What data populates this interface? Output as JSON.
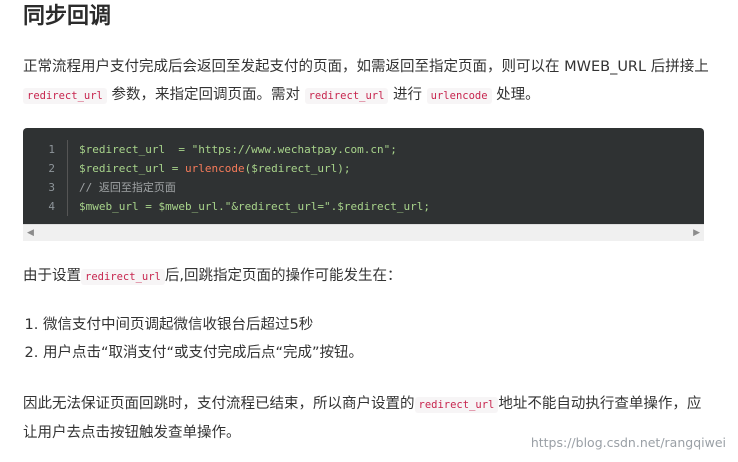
{
  "heading": "同步回调",
  "para1": {
    "text_a": "正常流程用户支付完成后会返回至发起支付的页面，如需返回至指定页面，则可以在 MWEB_URL 后拼接上 ",
    "code_a": "redirect_url",
    "text_b": " 参数，来指定回调页面。需对 ",
    "code_b": "redirect_url",
    "text_c": " 进行 ",
    "code_c": "urlencode",
    "text_d": " 处理。"
  },
  "code_block": {
    "lines": [
      {
        "num": "1",
        "text": "$redirect_url  = \"https://www.wechatpay.com.cn\";"
      },
      {
        "num": "2",
        "pre": "$redirect_url = ",
        "fn": "urlencode",
        "post": "($redirect_url);"
      },
      {
        "num": "3",
        "comment": "// 返回至指定页面"
      },
      {
        "num": "4",
        "text": "$mweb_url = $mweb_url.\"&redirect_url=\".$redirect_url;"
      }
    ]
  },
  "para2": {
    "text_a": "由于设置",
    "code_a": "redirect_url",
    "text_b": "后,回跳指定页面的操作可能发生在："
  },
  "list": [
    "微信支付中间页调起微信收银台后超过5秒",
    "用户点击“取消支付“或支付完成后点“完成”按钮。"
  ],
  "para3": {
    "text_a": "因此无法保证页面回跳时，支付流程已结束，所以商户设置的",
    "code_a": "redirect_url",
    "text_b": "地址不能自动执行查单操作，应让用户去点击按钮触发查单操作。"
  },
  "watermark": "https://blog.csdn.net/rangqiwei",
  "icons": {
    "scroll_left": "triangle-left-icon",
    "scroll_right": "triangle-right-icon"
  }
}
